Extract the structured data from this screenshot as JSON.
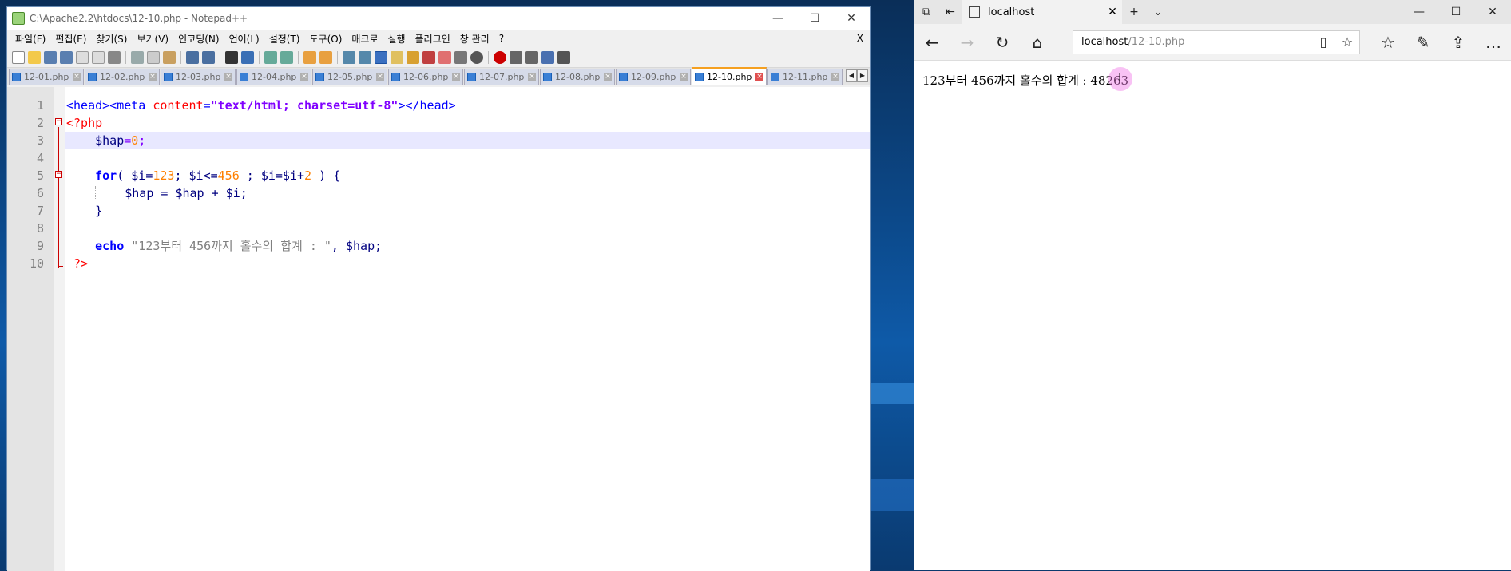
{
  "notepad": {
    "title": "C:\\Apache2.2\\htdocs\\12-10.php - Notepad++",
    "menu": [
      "파일(F)",
      "편집(E)",
      "찾기(S)",
      "보기(V)",
      "인코딩(N)",
      "언어(L)",
      "설정(T)",
      "도구(O)",
      "매크로",
      "실행",
      "플러그인",
      "창 관리",
      "?"
    ],
    "menu_close": "X",
    "tabs": [
      "12-01.php",
      "12-02.php",
      "12-03.php",
      "12-04.php",
      "12-05.php",
      "12-06.php",
      "12-07.php",
      "12-08.php",
      "12-09.php",
      "12-10.php",
      "12-11.php"
    ],
    "active_tab": "12-10.php",
    "line_numbers": [
      "1",
      "2",
      "3",
      "4",
      "5",
      "6",
      "7",
      "8",
      "9",
      "10"
    ],
    "code": {
      "l1_open": "<head><meta ",
      "l1_attr": "content",
      "l1_eq": "=",
      "l1_str": "\"text/html; charset=utf-8\"",
      "l1_close": "></head>",
      "l2": "<?php",
      "l3_var": "$hap",
      "l3_eq": "=",
      "l3_num": "0",
      "l3_semi": ";",
      "l5_kw": "for",
      "l5_a": "( $i=",
      "l5_n1": "123",
      "l5_b": "; $i<=",
      "l5_n2": "456",
      "l5_c": " ; $i=$i+",
      "l5_n3": "2",
      "l5_d": " ) {",
      "l6": "$hap = $hap + $i;",
      "l7": "}",
      "l9_kw": "echo",
      "l9_str": " \"123부터 456까지 홀수의 합계 : \"",
      "l9_rest": ", $hap;",
      "l10": "?>"
    }
  },
  "edge": {
    "tab_title": "localhost",
    "address_host": "localhost",
    "address_path": "/12-10.php",
    "page_output": "123부터 456까지 홀수의 합계 : 48263"
  }
}
